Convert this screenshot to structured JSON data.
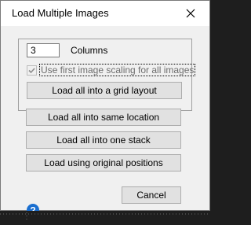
{
  "window": {
    "title": "Load Multiple Images"
  },
  "grid_options": {
    "columns_value": "3",
    "columns_label": "Columns",
    "scaling_checkbox_label": "Use first image scaling for all images",
    "scaling_checkbox_checked": true,
    "scaling_checkbox_enabled": false,
    "grid_button_label": "Load all into a grid layout"
  },
  "buttons": {
    "same_location_label": "Load all into same location",
    "one_stack_label": "Load all into one stack",
    "original_positions_label": "Load using original positions",
    "cancel_label": "Cancel"
  },
  "icons": {
    "close": "close-icon",
    "help": "help-icon",
    "check": "checkmark-icon"
  },
  "colors": {
    "help_icon": "#1a6fd0",
    "button_face": "#e1e1e1",
    "dialog_bg": "#f0f0f0"
  }
}
